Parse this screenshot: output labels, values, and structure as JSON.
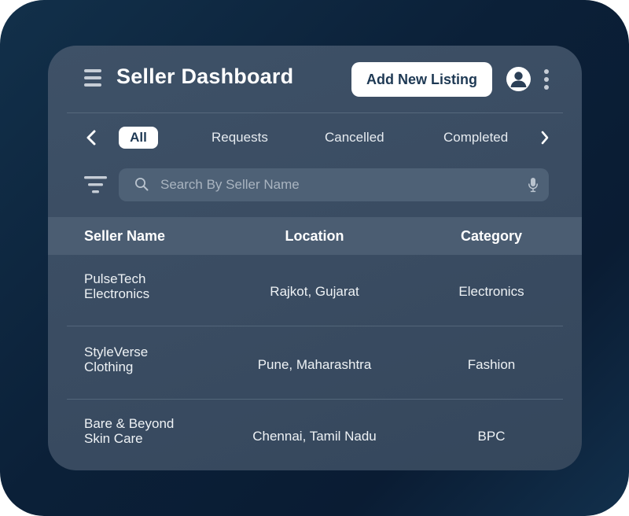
{
  "header": {
    "title": "Seller Dashboard",
    "add_button_label": "Add New Listing"
  },
  "tabs": [
    {
      "label": "All",
      "active": true
    },
    {
      "label": "Requests",
      "active": false
    },
    {
      "label": "Cancelled",
      "active": false
    },
    {
      "label": "Completed",
      "active": false
    }
  ],
  "search": {
    "placeholder": "Search By Seller Name",
    "value": ""
  },
  "table": {
    "columns": [
      "Seller Name",
      "Location",
      "Category"
    ],
    "rows": [
      {
        "name_line1": "PulseTech",
        "name_line2": "Electronics",
        "location": "Rajkot, Gujarat",
        "category": "Electronics"
      },
      {
        "name_line1": "StyleVerse",
        "name_line2": "Clothing",
        "location": "Pune, Maharashtra",
        "category": "Fashion"
      },
      {
        "name_line1": "Bare & Beyond",
        "name_line2": "Skin Care",
        "location": "Chennai, Tamil Nadu",
        "category": "BPC"
      }
    ]
  },
  "icons": {
    "menu": "hamburger-menu-icon",
    "avatar": "user-avatar-icon",
    "more": "kebab-more-icon",
    "prev": "chevron-left-icon",
    "next": "chevron-right-icon",
    "filter": "filter-icon",
    "search": "search-icon",
    "mic": "microphone-icon"
  },
  "colors": {
    "background": "#0b2038",
    "card": "#3a4c62",
    "table_header": "#4b5d72",
    "accent_text": "#1e3954",
    "button_bg": "#ffffff"
  }
}
